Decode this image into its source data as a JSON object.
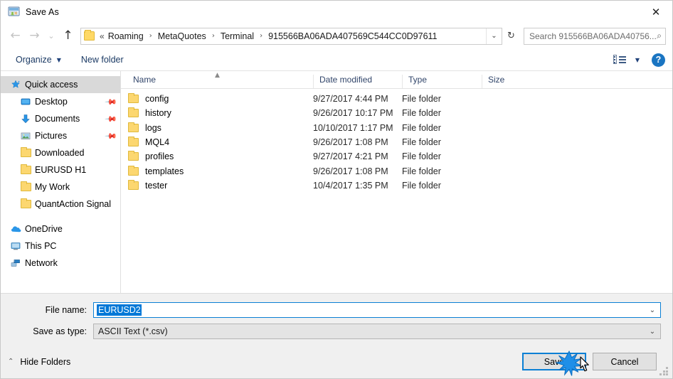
{
  "window": {
    "title": "Save As",
    "icon": "save-as-icon",
    "close_label": "✕"
  },
  "navigation": {
    "back_icon": "back-arrow-icon",
    "back_glyph": "←",
    "forward_icon": "forward-arrow-icon",
    "forward_glyph": "→",
    "recent_icon": "chevron-down-icon",
    "recent_glyph": "⌄",
    "up_icon": "up-arrow-icon",
    "up_glyph": "↑",
    "refresh_icon": "refresh-icon",
    "refresh_glyph": "↻",
    "dropdown_glyph": "⌄"
  },
  "breadcrumb": {
    "lead": "«",
    "separator": "›",
    "items": [
      "Roaming",
      "MetaQuotes",
      "Terminal",
      "915566BA06ADA407569C544CC0D97611"
    ]
  },
  "search": {
    "placeholder": "Search 915566BA06ADA40756...",
    "icon": "search-icon",
    "icon_glyph": "⌕"
  },
  "toolbar": {
    "organize_label": "Organize",
    "organize_caret": "▼",
    "new_folder_label": "New folder",
    "view_icon": "view-options-icon",
    "view_caret": "▼",
    "help_label": "?",
    "help_icon": "help-icon"
  },
  "sidebar": {
    "items": [
      {
        "label": "Quick access",
        "icon": "star-icon",
        "selected": true,
        "indent": false,
        "pinned": false
      },
      {
        "label": "Desktop",
        "icon": "desktop-icon",
        "selected": false,
        "indent": true,
        "pinned": true
      },
      {
        "label": "Documents",
        "icon": "documents-icon",
        "selected": false,
        "indent": true,
        "pinned": true
      },
      {
        "label": "Pictures",
        "icon": "pictures-icon",
        "selected": false,
        "indent": true,
        "pinned": true
      },
      {
        "label": "Downloaded",
        "icon": "folder-icon",
        "selected": false,
        "indent": true,
        "pinned": false
      },
      {
        "label": "EURUSD H1",
        "icon": "folder-icon",
        "selected": false,
        "indent": true,
        "pinned": false
      },
      {
        "label": "My Work",
        "icon": "folder-icon",
        "selected": false,
        "indent": true,
        "pinned": false
      },
      {
        "label": "QuantAction Signal",
        "icon": "folder-icon",
        "selected": false,
        "indent": true,
        "pinned": false
      }
    ],
    "groups": [
      {
        "label": "OneDrive",
        "icon": "onedrive-icon"
      },
      {
        "label": "This PC",
        "icon": "this-pc-icon"
      },
      {
        "label": "Network",
        "icon": "network-icon"
      }
    ],
    "pin_glyph": "📌"
  },
  "filelist": {
    "columns": [
      "Name",
      "Date modified",
      "Type",
      "Size"
    ],
    "sort_glyph": "▲",
    "sort_column": "Name",
    "rows": [
      {
        "name": "config",
        "date": "9/27/2017 4:44 PM",
        "type": "File folder",
        "size": ""
      },
      {
        "name": "history",
        "date": "9/26/2017 10:17 PM",
        "type": "File folder",
        "size": ""
      },
      {
        "name": "logs",
        "date": "10/10/2017 1:17 PM",
        "type": "File folder",
        "size": ""
      },
      {
        "name": "MQL4",
        "date": "9/26/2017 1:08 PM",
        "type": "File folder",
        "size": ""
      },
      {
        "name": "profiles",
        "date": "9/27/2017 4:21 PM",
        "type": "File folder",
        "size": ""
      },
      {
        "name": "templates",
        "date": "9/26/2017 1:08 PM",
        "type": "File folder",
        "size": ""
      },
      {
        "name": "tester",
        "date": "10/4/2017 1:35 PM",
        "type": "File folder",
        "size": ""
      }
    ]
  },
  "form": {
    "filename_label": "File name:",
    "filename_value": "EURUSD2",
    "filetype_label": "Save as type:",
    "filetype_value": "ASCII Text (*.csv)",
    "caret_glyph": "⌄"
  },
  "footer": {
    "hide_folders_label": "Hide Folders",
    "hide_folders_caret": "⌃",
    "save_label": "Save",
    "cancel_label": "Cancel"
  },
  "colors": {
    "accent": "#0a7fd4",
    "selection": "#0078d7",
    "folder": "#fcd770",
    "sidebar_selected": "#d9d9d9",
    "column_header_text": "#31456a",
    "help_blue": "#1a75c2"
  }
}
